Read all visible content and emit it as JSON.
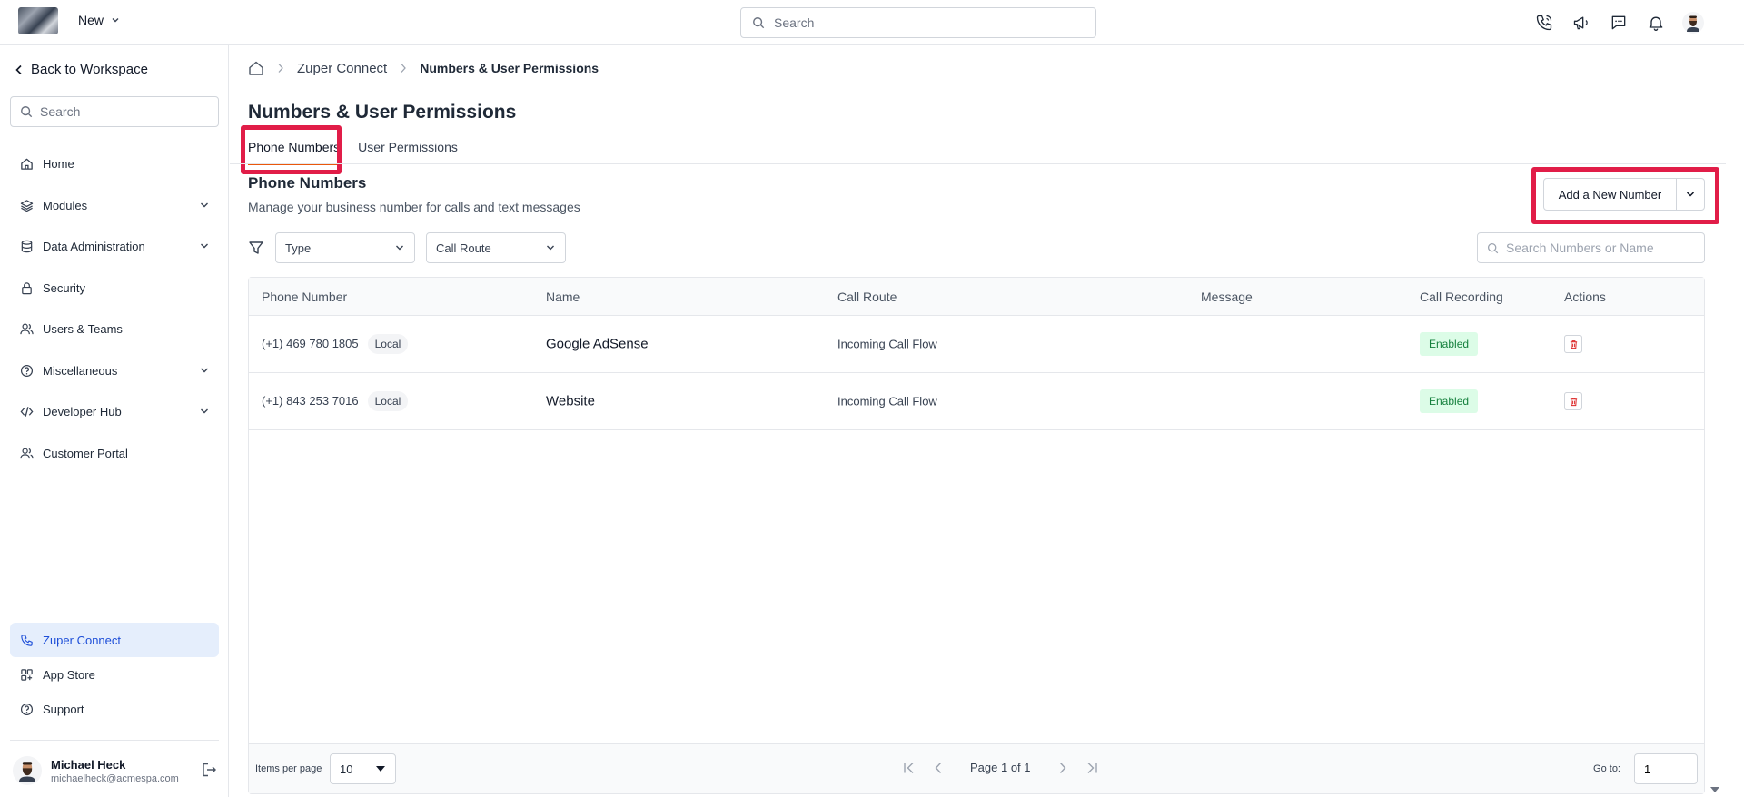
{
  "topbar": {
    "new_label": "New",
    "search_placeholder": "Search",
    "icons": [
      "phone-icon",
      "megaphone-icon",
      "chat-icon",
      "bell-icon",
      "avatar"
    ]
  },
  "sidebar": {
    "back_label": "Back to Workspace",
    "search_placeholder": "Search",
    "items": [
      {
        "label": "Home",
        "icon": "home-icon"
      },
      {
        "label": "Modules",
        "icon": "layers-icon"
      },
      {
        "label": "Data Administration",
        "icon": "database-icon"
      },
      {
        "label": "Security",
        "icon": "lock-icon"
      },
      {
        "label": "Users & Teams",
        "icon": "users-icon"
      },
      {
        "label": "Miscellaneous",
        "icon": "help-icon"
      },
      {
        "label": "Developer Hub",
        "icon": "code-icon"
      },
      {
        "label": "Customer Portal",
        "icon": "users-icon"
      }
    ],
    "bottom_items": [
      {
        "label": "Zuper Connect",
        "icon": "phone-icon",
        "active": true
      },
      {
        "label": "App Store",
        "icon": "grid-icon"
      },
      {
        "label": "Support",
        "icon": "help-icon"
      }
    ],
    "user": {
      "name": "Michael Heck",
      "email": "michaelheck@acmespa.com"
    }
  },
  "breadcrumb": {
    "items": [
      "Zuper Connect",
      "Numbers & User Permissions"
    ]
  },
  "page": {
    "title": "Numbers & User Permissions",
    "tabs": [
      {
        "label": "Phone Numbers",
        "active": true
      },
      {
        "label": "User Permissions",
        "active": false
      }
    ],
    "section_title": "Phone Numbers",
    "section_subtitle": "Manage your business number for calls and text messages",
    "add_button_label": "Add a New Number",
    "filters": {
      "type": "Type",
      "call_route": "Call Route"
    },
    "search_placeholder": "Search Numbers or Name"
  },
  "table": {
    "columns": [
      "Phone Number",
      "Name",
      "Call Route",
      "Message",
      "Call Recording",
      "Actions"
    ],
    "rows": [
      {
        "phone": "(+1) 469 780 1805",
        "type": "Local",
        "name": "Google AdSense",
        "call_route": "Incoming Call Flow",
        "message": "",
        "recording": "Enabled"
      },
      {
        "phone": "(+1) 843 253 7016",
        "type": "Local",
        "name": "Website",
        "call_route": "Incoming Call Flow",
        "message": "",
        "recording": "Enabled"
      }
    ]
  },
  "pagination": {
    "items_per_page_label": "Items per page",
    "items_per_page": "10",
    "page_text": "Page 1 of 1",
    "goto_label": "Go to:",
    "goto_value": "1"
  },
  "colors": {
    "accent": "#ea580c",
    "highlight": "#e11d48",
    "active_nav": "#e5eefc",
    "enabled_bg": "#dcfce7",
    "enabled_text": "#15803d"
  }
}
